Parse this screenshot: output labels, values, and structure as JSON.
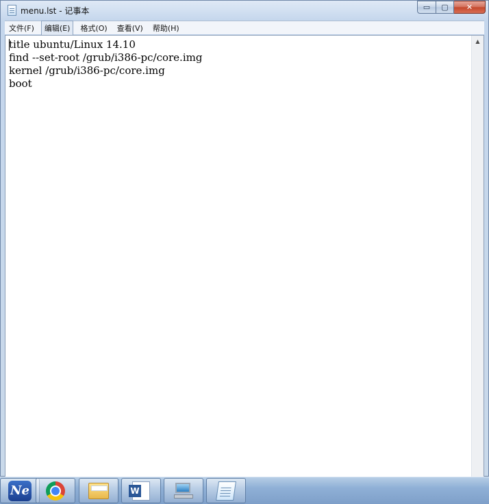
{
  "window": {
    "title": "menu.lst - 记事本",
    "icon": "notepad-icon",
    "controls": {
      "minimize": "▭",
      "maximize": "▢",
      "close": "✕"
    }
  },
  "menubar": {
    "items": [
      {
        "label": "文件(F)"
      },
      {
        "label": "编辑(E)"
      },
      {
        "label": "格式(O)"
      },
      {
        "label": "查看(V)"
      },
      {
        "label": "帮助(H)"
      }
    ],
    "active_index": 1
  },
  "editor": {
    "lines": [
      "title ubuntu/Linux 14.10",
      "find --set-root /grub/i386-pc/core.img",
      "kernel /grub/i386-pc/core.img",
      "boot"
    ],
    "scroll_up_glyph": "▲"
  },
  "taskbar": {
    "buttons": [
      {
        "icon": "ne-icon",
        "label": "Ne"
      },
      {
        "icon": "chrome-icon"
      },
      {
        "icon": "file-explorer-icon"
      },
      {
        "icon": "word-icon"
      },
      {
        "icon": "computer-icon"
      },
      {
        "icon": "notepad-icon"
      }
    ]
  }
}
